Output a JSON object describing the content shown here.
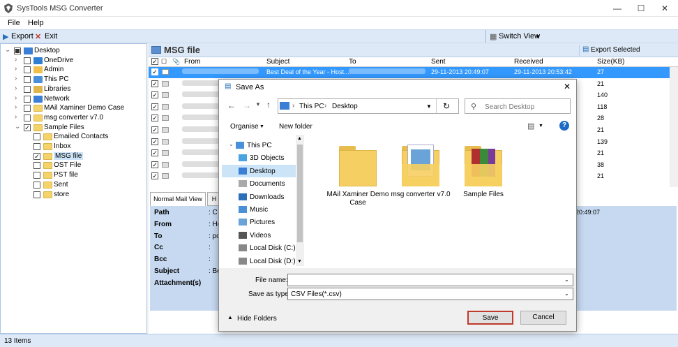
{
  "app": {
    "title": "SysTools MSG Converter",
    "menu": [
      "File",
      "Help"
    ],
    "toolbar": {
      "export": "Export",
      "exit": "Exit",
      "switch_view": "Switch View"
    }
  },
  "tree": [
    {
      "label": "Desktop",
      "indent": 0,
      "checked": "partial",
      "icon": "desktop-icon"
    },
    {
      "label": "OneDrive",
      "indent": 1,
      "checked": false,
      "icon": "cloud-icon"
    },
    {
      "label": "Admin",
      "indent": 1,
      "checked": false,
      "icon": "user-icon"
    },
    {
      "label": "This PC",
      "indent": 1,
      "checked": false,
      "icon": "computer-icon"
    },
    {
      "label": "Libraries",
      "indent": 1,
      "checked": false,
      "icon": "library-icon"
    },
    {
      "label": "Network",
      "indent": 1,
      "checked": false,
      "icon": "network-icon"
    },
    {
      "label": "MAil Xaminer Demo Case",
      "indent": 1,
      "checked": false,
      "icon": "folder-icon"
    },
    {
      "label": "msg converter v7.0",
      "indent": 1,
      "checked": false,
      "icon": "folder-icon"
    },
    {
      "label": "Sample Files",
      "indent": 1,
      "checked": true,
      "icon": "folder-icon",
      "expanded": true
    },
    {
      "label": "Emailed Contacts",
      "indent": 2,
      "checked": false,
      "icon": "folder-icon"
    },
    {
      "label": "Inbox",
      "indent": 2,
      "checked": false,
      "icon": "folder-icon"
    },
    {
      "label": "MSG file",
      "indent": 2,
      "checked": true,
      "icon": "folder-icon",
      "selected": true
    },
    {
      "label": "OST File",
      "indent": 2,
      "checked": false,
      "icon": "folder-icon"
    },
    {
      "label": "PST file",
      "indent": 2,
      "checked": false,
      "icon": "folder-icon"
    },
    {
      "label": "Sent",
      "indent": 2,
      "checked": false,
      "icon": "folder-icon"
    },
    {
      "label": "store",
      "indent": 2,
      "checked": false,
      "icon": "folder-icon"
    }
  ],
  "main": {
    "header": "MSG file",
    "export_selected": "Export Selected",
    "columns": [
      "From",
      "Subject",
      "To",
      "Sent",
      "Received",
      "Size(KB)"
    ],
    "rows": [
      {
        "subject": "Best Deal of the Year - Host...",
        "sent": "29-11-2013 20:49:07",
        "received": "29-11-2013 20:53:42",
        "size": "27"
      },
      {
        "size": "21"
      },
      {
        "size": "140"
      },
      {
        "size": "118"
      },
      {
        "size": "28"
      },
      {
        "size": "21"
      },
      {
        "size": "139"
      },
      {
        "size": "21"
      },
      {
        "size": "38"
      },
      {
        "size": "21"
      }
    ]
  },
  "preview": {
    "tabs": [
      "Normal Mail View",
      "H"
    ],
    "fields": [
      "Path",
      "From",
      "To",
      "Cc",
      "Bcc",
      "Subject",
      "Attachment(s)"
    ],
    "values": [
      ": C",
      ": Ho",
      ": po",
      ":",
      ":",
      ": Be",
      ""
    ],
    "time_fragment": "20:49:07"
  },
  "status": "13 Items",
  "dialog": {
    "title": "Save As",
    "path": [
      "This PC",
      "Desktop"
    ],
    "search_placeholder": "Search Desktop",
    "organise": "Organise",
    "new_folder": "New folder",
    "nav": [
      {
        "label": "This PC",
        "icon": "computer-icon"
      },
      {
        "label": "3D Objects",
        "icon": "cube-icon"
      },
      {
        "label": "Desktop",
        "icon": "desktop-icon",
        "selected": true
      },
      {
        "label": "Documents",
        "icon": "document-icon"
      },
      {
        "label": "Downloads",
        "icon": "download-icon"
      },
      {
        "label": "Music",
        "icon": "music-icon"
      },
      {
        "label": "Pictures",
        "icon": "picture-icon"
      },
      {
        "label": "Videos",
        "icon": "video-icon"
      },
      {
        "label": "Local Disk (C:)",
        "icon": "disk-icon"
      },
      {
        "label": "Local Disk (D:)",
        "icon": "disk-icon"
      }
    ],
    "files": [
      "MAil Xaminer Demo Case",
      "msg converter v7.0",
      "Sample Files"
    ],
    "file_name_label": "File name:",
    "file_name_value": "",
    "save_type_label": "Save as type:",
    "save_type_value": "CSV Files(*.csv)",
    "hide_folders": "Hide Folders",
    "save": "Save",
    "cancel": "Cancel"
  },
  "colors": {
    "accent": "#3399ff",
    "selected_row": "#3399ff",
    "save_border": "#c0392b",
    "panel": "#dde9f7"
  }
}
